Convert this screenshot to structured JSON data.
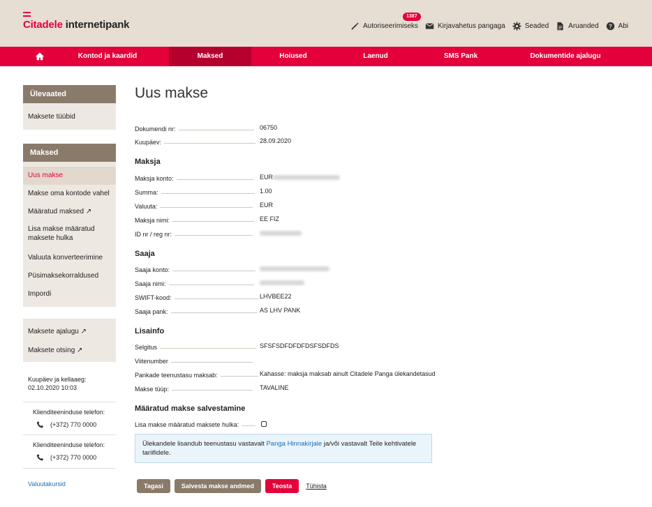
{
  "logo": {
    "brand": "Citadele",
    "product": " internetipank"
  },
  "topnav": {
    "badge": "1387",
    "authorize": "Autoriseerimiseks",
    "messages": "Kirjavahetus pangaga",
    "settings": "Seaded",
    "reports": "Aruanded",
    "help": "Abi"
  },
  "mainnav": {
    "items": [
      "Kontod ja kaardid",
      "Maksed",
      "Hoiused",
      "Laenud",
      "SMS Pank",
      "Dokumentide ajalugu"
    ],
    "active": "Maksed"
  },
  "sidebar": {
    "overview_head": "Ülevaated",
    "overview_items": [
      "Maksete tüübid"
    ],
    "payments_head": "Maksed",
    "payments_items": [
      "Uus makse",
      "Makse oma kontode vahel",
      "Määratud maksed ↗",
      "Lisa makse määratud maksete hulka",
      "Valuuta konverteerimine",
      "Püsimaksekorraldused",
      "Impordi"
    ],
    "history_items": [
      "Maksete ajalugu ↗",
      "Maksete otsing ↗"
    ],
    "datetime_label": "Kuupäev ja kellaaeg:",
    "datetime_value": "02.10.2020 10:03",
    "phone_label_1": "Klienditeeninduse telefon:",
    "phone_1": "(+372) 770 0000",
    "phone_label_2": "Klienditeeninduse telefon:",
    "phone_2": "(+372) 770 0000",
    "currency_link": "Valuutakursid"
  },
  "form": {
    "title": "Uus makse",
    "doc_no_label": "Dokumendi nr:",
    "doc_no": "06750",
    "date_label": "Kuupäev:",
    "date": "28.09.2020",
    "payer_title": "Maksja",
    "payer_account_label": "Maksja konto:",
    "payer_account_prefix": "EUR",
    "amount_label": "Summa:",
    "amount": "1.00",
    "currency_label": "Valuuta:",
    "currency": "EUR",
    "payer_name_label": "Maksja nimi:",
    "payer_name": "EE FIZ",
    "id_label": "ID nr / reg nr:",
    "recipient_title": "Saaja",
    "recipient_account_label": "Saaja konto:",
    "recipient_name_label": "Saaja nimi:",
    "swift_label": "SWIFT-kood:",
    "swift": "LHVBEE22",
    "bank_label": "Saaja pank:",
    "bank": "AS LHV PANK",
    "extra_title": "Lisainfo",
    "explanation_label": "Selgitus",
    "explanation": "SFSFSDFDFDFDSFSDFDS",
    "reference_label": "Viitenumber",
    "fee_label": "Pankade teenustasu maksab:",
    "fee": "Kahasse: maksja maksab ainult Citadele Panga ülekandetasud",
    "type_label": "Makse tüüp:",
    "type": "TAVALINE",
    "save_title": "Määratud makse salvestamine",
    "save_label": "Lisa makse määratud maksete hulka:"
  },
  "notice": {
    "text_before": "Ülekandele lisandub teenustasu vastavalt ",
    "link": "Panga Hinnakirjale",
    "text_after": " ja/või vastavalt Teile kehtivatele tariifidele."
  },
  "buttons": {
    "back": "Tagasi",
    "save": "Salvesta makse andmed",
    "execute": "Teosta",
    "cancel": "Tühista"
  },
  "colors": {
    "brand_red": "#e4003a",
    "header_bg": "#e6ddd3",
    "sidebar_head": "#8a7a6a"
  }
}
